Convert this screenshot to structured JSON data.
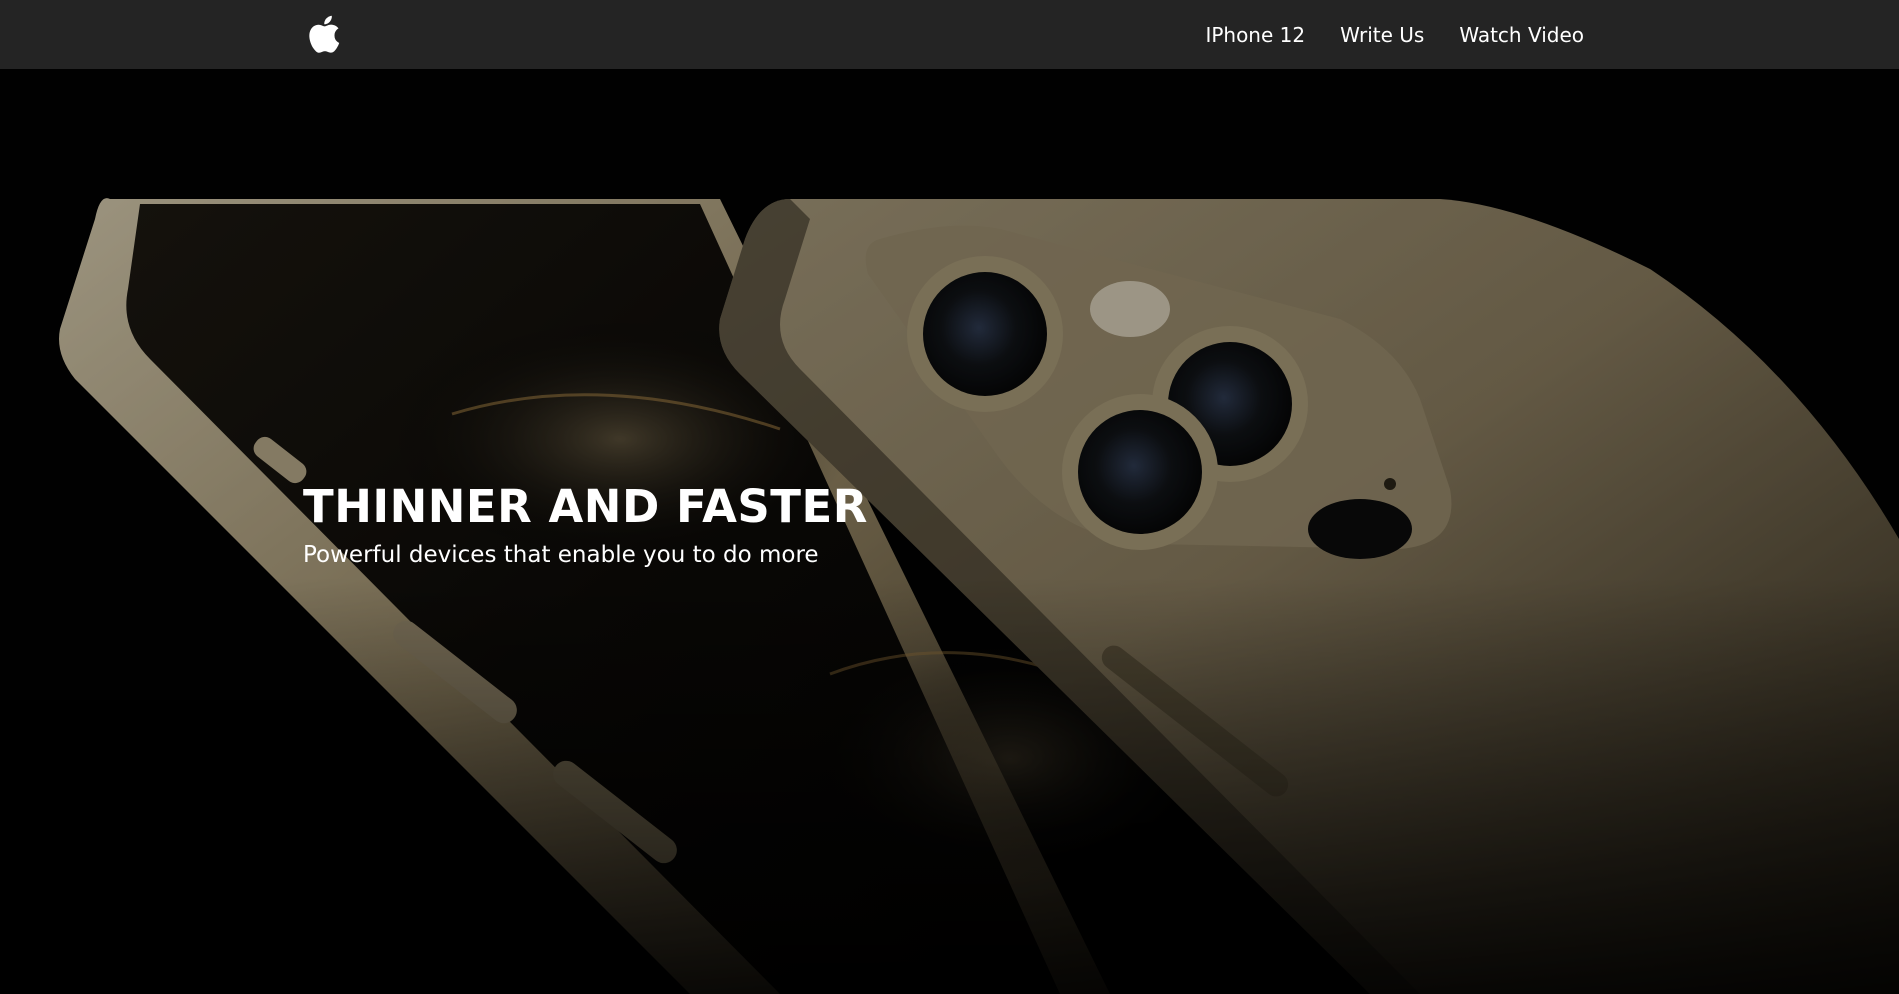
{
  "navbar": {
    "logo_icon": "apple-logo-icon",
    "links": [
      {
        "label": "IPhone 12"
      },
      {
        "label": "Write Us"
      },
      {
        "label": "Watch Video"
      }
    ]
  },
  "hero": {
    "title": "THINNER AND FASTER",
    "subtitle": "Powerful devices that enable you to do more",
    "image": "gold-iphone-12-pro-product-photo"
  },
  "colors": {
    "navbar_bg": "#242424",
    "hero_bg": "#000000",
    "text": "#ffffff",
    "phone_gold": "#c9bb98"
  }
}
